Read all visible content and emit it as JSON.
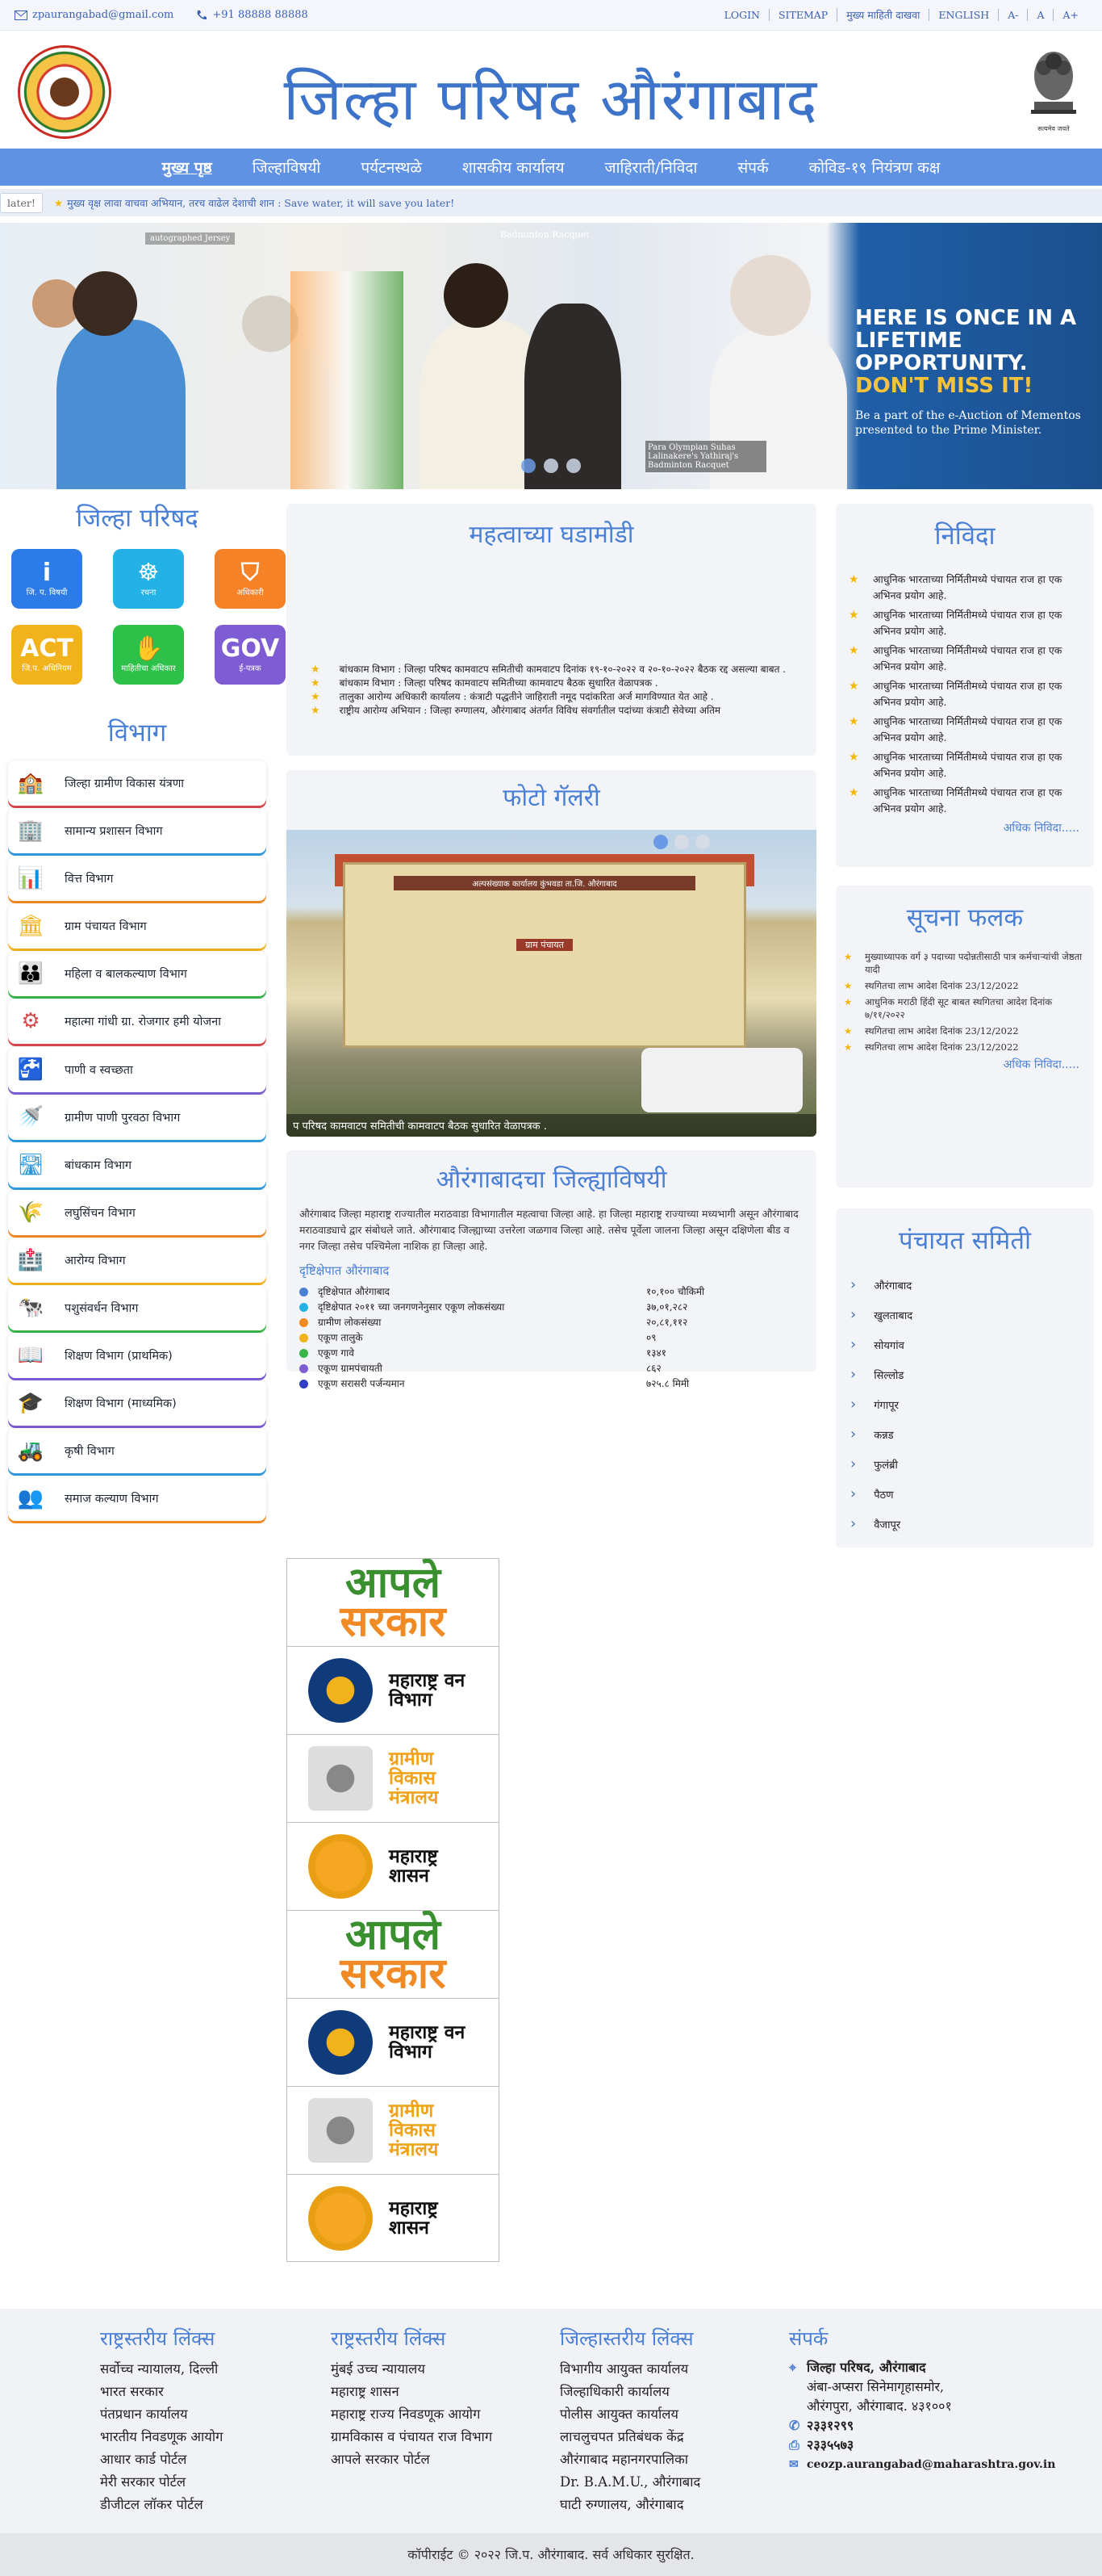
{
  "topbar": {
    "email": "zpaurangabad@gmail.com",
    "phone": "+91 88888 88888",
    "links": [
      "LOGIN",
      "SITEMAP",
      "मुख्य माहिती दाखवा",
      "ENGLISH",
      "A-",
      "A",
      "A+"
    ]
  },
  "header": {
    "title": "जिल्हा परिषद औरंगाबाद",
    "emblem_text": "सत्यमेव जयते"
  },
  "nav": [
    "मुख्य पृष्ठ",
    "जिल्हाविषयी",
    "पर्यटनस्थळे",
    "शासकीय कार्यालय",
    "जाहिराती/निविदा",
    "संपर्क",
    "कोविड-१९ नियंत्रण कक्ष"
  ],
  "ticker": {
    "label": "later!",
    "text": "मुख्य वृक्ष लावा वाचवा अभियान, तरच वाढेल देशाची शान : Save water, it will save you later!"
  },
  "banner": {
    "headline_1": "HERE IS ONCE IN A",
    "headline_2": "LIFETIME OPPORTUNITY.",
    "headline_3": "DON'T MISS IT!",
    "sub": "Be a part of the e-Auction of Mementos presented to the Prime Minister.",
    "caption": "Para Olympian Suhas Lalinakere's Yathiraj's Badminton Racquet",
    "caption_top": "Badminton Racquet",
    "caption_left": "autographed Jersey"
  },
  "left": {
    "title": "जिल्हा परिषद",
    "tiles": [
      {
        "icon": "i",
        "label": "जि. प. विषयी",
        "color": "#2d7be6"
      },
      {
        "icon": "☸",
        "label": "रचना",
        "color": "#24b1e6"
      },
      {
        "icon": "⛉",
        "label": "अधिकारी",
        "color": "#f58226"
      },
      {
        "icon": "ACT",
        "label": "जि.प. अधिनियम",
        "color": "#f2b21c"
      },
      {
        "icon": "✋",
        "label": "माहितीचा अधिकार",
        "color": "#2ec14a"
      },
      {
        "icon": "GOV",
        "label": "ई-पत्रक",
        "color": "#7d5cd4"
      }
    ],
    "vibhag_title": "विभाग",
    "departments": [
      {
        "label": "जिल्हा ग्रामीण विकास यंत्रणा",
        "icon": "🏫",
        "color": "#d8494e"
      },
      {
        "label": "सामान्य प्रशासन विभाग",
        "icon": "🏢",
        "color": "#2f9ae0"
      },
      {
        "label": "वित्त विभाग",
        "icon": "📊",
        "color": "#ef8a24"
      },
      {
        "label": "ग्राम पंचायत विभाग",
        "icon": "🏛",
        "color": "#f2b21c"
      },
      {
        "label": "महिला व बालकल्याण विभाग",
        "icon": "👪",
        "color": "#39b54a"
      },
      {
        "label": "महात्मा गांधी ग्रा. रोजगार हमी योजना",
        "icon": "⚙",
        "color": "#d8494e"
      },
      {
        "label": "पाणी व स्वच्छता",
        "icon": "🚰",
        "color": "#7d5cd4"
      },
      {
        "label": "ग्रामीण पाणी पुरवठा विभाग",
        "icon": "🚿",
        "color": "#2f9ae0"
      },
      {
        "label": "बांधकाम विभाग",
        "icon": "🛣",
        "color": "#2f9ae0"
      },
      {
        "label": "लघुसिंचन विभाग",
        "icon": "🌾",
        "color": "#ef8a24"
      },
      {
        "label": "आरोग्य विभाग",
        "icon": "🏥",
        "color": "#f2b21c"
      },
      {
        "label": "पशुसंवर्धन विभाग",
        "icon": "🐄",
        "color": "#39b54a"
      },
      {
        "label": "शिक्षण विभाग (प्राथमिक)",
        "icon": "📖",
        "color": "#7d5cd4"
      },
      {
        "label": "शिक्षण विभाग (माध्यमिक)",
        "icon": "🎓",
        "color": "#7d5cd4"
      },
      {
        "label": "कृषी विभाग",
        "icon": "🚜",
        "color": "#2f9ae0"
      },
      {
        "label": "समाज कल्याण विभाग",
        "icon": "👥",
        "color": "#ef8a24"
      }
    ]
  },
  "ghadamodi": {
    "title": "महत्वाच्या घडामोडी",
    "items": [
      "बांधकाम विभाग : जिल्हा परिषद कामवाटप समितीची कामवाटप दिनांक १९-१०-२०२२ व २०-१०-२०२२ बैठक रद्द असल्या बाबत .",
      "बांधकाम विभाग : जिल्हा परिषद कामवाटप समितीच्या कामवाटप बैठक सुधारित वेळापत्रक .",
      "तालुका आरोग्य अधिकारी कार्यालय : कंत्राटी पद्धतीने जाहिराती नमूद पदांकरिता अर्ज मागविण्यात येत आहे .",
      "राष्ट्रीय आरोग्य अभियान : जिल्हा रुग्णालय, औरंगाबाद अंतर्गत विविध संवर्गातील पदांच्या कंत्राटी सेवेच्या अतिम"
    ]
  },
  "gallery": {
    "title": "फोटो गॅलरी",
    "caption": "प परिषद कामवाटप समितीची कामवाटप बैठक सुधारित वेळापत्रक .",
    "sign": "अल्पसंख्याक कार्यालय कुंभवडा ता.जि. औरंगाबाद",
    "sign2": "ग्राम पंचायत"
  },
  "aurangabad": {
    "title": "औरंगाबादचा जिल्ह्याविषयी",
    "text": "औरंगाबाद जिल्हा महाराष्ट्र राज्यातील मराठवाडा विभागातील महत्वाचा जिल्हा आहे. हा जिल्हा महाराष्ट्र राज्याच्या मध्यभागी असून औरंगाबाद मराठवाड्याचे द्वार संबोधले जाते. औरंगाबाद जिल्ह्याच्या उत्तरेला जळगाव जिल्हा आहे. तसेच पूर्वेला जालना जिल्हा असून दक्षिणेला बीड व नगर जिल्हा तसेच पश्चिमेला नाशिक हा जिल्हा आहे.",
    "sub": "दृष्टिक्षेपात औरंगाबाद",
    "stats": [
      {
        "k": "दृष्टिक्षेपात औरंगाबाद",
        "v": "१०,१०० चौकिमी",
        "color": "#4a7fd6"
      },
      {
        "k": "दृष्टिक्षेपात २०११ च्या जनगणनेनुसार एकूण लोकसंख्या",
        "v": "३७,०१,२८२",
        "color": "#24b1e6"
      },
      {
        "k": "ग्रामीण लोकसंख्या",
        "v": "२०,८१,११२",
        "color": "#ef8a24"
      },
      {
        "k": "एकूण तालुके",
        "v": "०९",
        "color": "#f2b21c"
      },
      {
        "k": "एकूण गावे",
        "v": "१३४१",
        "color": "#39b54a"
      },
      {
        "k": "एकूण ग्रामपंचायती",
        "v": "८६२",
        "color": "#7d5cd4"
      },
      {
        "k": "एकूण सरासरी पर्जन्यमान",
        "v": "७२५.८ मिमी",
        "color": "#2f3ec5"
      }
    ]
  },
  "nivida": {
    "title": "निविदा",
    "items": [
      "आधुनिक भारताच्या निर्मितीमध्ये पंचायत राज हा एक अभिनव प्रयोग आहे.",
      "आधुनिक भारताच्या निर्मितीमध्ये पंचायत राज हा एक अभिनव प्रयोग आहे.",
      "आधुनिक भारताच्या निर्मितीमध्ये पंचायत राज हा एक अभिनव प्रयोग आहे.",
      "आधुनिक भारताच्या निर्मितीमध्ये पंचायत राज हा एक अभिनव प्रयोग आहे.",
      "आधुनिक भारताच्या निर्मितीमध्ये पंचायत राज हा एक अभिनव प्रयोग आहे.",
      "आधुनिक भारताच्या निर्मितीमध्ये पंचायत राज हा एक अभिनव प्रयोग आहे.",
      "आधुनिक भारताच्या निर्मितीमध्ये पंचायत राज हा एक अभिनव प्रयोग आहे."
    ],
    "more": "अधिक निविदा....."
  },
  "suchana": {
    "title": "सूचना फलक",
    "items": [
      "मुख्याध्यापक वर्ग ३ पदाच्या पदोन्नतीसाठी पात्र कर्मचाऱ्यांची जेष्ठता यादी",
      "स्थगितचा लाभ आदेश दिनांक 23/12/2022",
      "आधुनिक मराठी हिंदी सूट बाबत स्थगितचा आदेश दिनांक ७/११/२०२२",
      "स्थगितचा लाभ आदेश दिनांक 23/12/2022",
      "स्थगितचा लाभ आदेश दिनांक 23/12/2022"
    ],
    "more": "अधिक निविदा....."
  },
  "panchayat": {
    "title": "पंचायत समिती",
    "items": [
      "औरंगाबाद",
      "खुलताबाद",
      "सोयगांव",
      "सिल्लोड",
      "गंगापूर",
      "कन्नड",
      "फुलंब्री",
      "पैठण",
      "वैजापूर"
    ]
  },
  "logos": [
    {
      "type": "aple",
      "t1": "आपले",
      "t2": "सरकार"
    },
    {
      "type": "van",
      "text": "महाराष्ट्र वन विभाग"
    },
    {
      "type": "gram",
      "text": "ग्रामीण विकास मंत्रालय"
    },
    {
      "type": "shasan",
      "text": "महाराष्ट्र शासन"
    },
    {
      "type": "aple",
      "t1": "आपले",
      "t2": "सरकार"
    },
    {
      "type": "van",
      "text": "महाराष्ट्र वन विभाग"
    },
    {
      "type": "gram",
      "text": "ग्रामीण विकास मंत्रालय"
    },
    {
      "type": "shasan",
      "text": "महाराष्ट्र शासन"
    }
  ],
  "footer": {
    "col1": {
      "title": "राष्ट्रस्तरीय लिंक्स",
      "items": [
        "सर्वोच्च न्यायालय, दिल्ली",
        "भारत सरकार",
        "पंतप्रधान कार्यालय",
        "भारतीय निवडणूक आयोग",
        "आधार कार्ड पोर्टल",
        "मेरी सरकार पोर्टल",
        "डीजीटल लॉकर पोर्टल"
      ]
    },
    "col2": {
      "title": "राष्ट्रस्तरीय लिंक्स",
      "items": [
        "मुंबई उच्च न्यायालय",
        "महाराष्ट्र शासन",
        "महाराष्ट्र राज्य निवडणूक आयोग",
        "ग्रामविकास व पंचायत राज विभाग",
        "आपले सरकार पोर्टल"
      ]
    },
    "col3": {
      "title": "जिल्हास्तरीय लिंक्स",
      "items": [
        "विभागीय आयुक्त कार्यालय",
        "जिल्हाधिकारी कार्यालय",
        "पोलीस आयुक्त कार्यालय",
        "लाचलुचपत प्रतिबंधक केंद्र",
        "औरंगाबाद महानगरपालिका",
        "Dr. B.A.M.U., औरंगाबाद",
        "घाटी रुग्णालय, औरंगाबाद"
      ]
    },
    "col4": {
      "title": "संपर्क",
      "org": "जिल्हा परिषद, औरंगाबाद",
      "addr1": "अंबा-अप्सरा सिनेमागृहासमोर,",
      "addr2": "औरंगपुरा, औरंगाबाद. ४३१००१",
      "phone": "२३३१२९९",
      "fax": "२३३५५७३",
      "email": "ceozp.aurangabad@maharashtra.gov.in"
    }
  },
  "copyright": "कॉपीराईट © २०२२ जि.प. औरंगाबाद. सर्व अधिकार सुरक्षित."
}
